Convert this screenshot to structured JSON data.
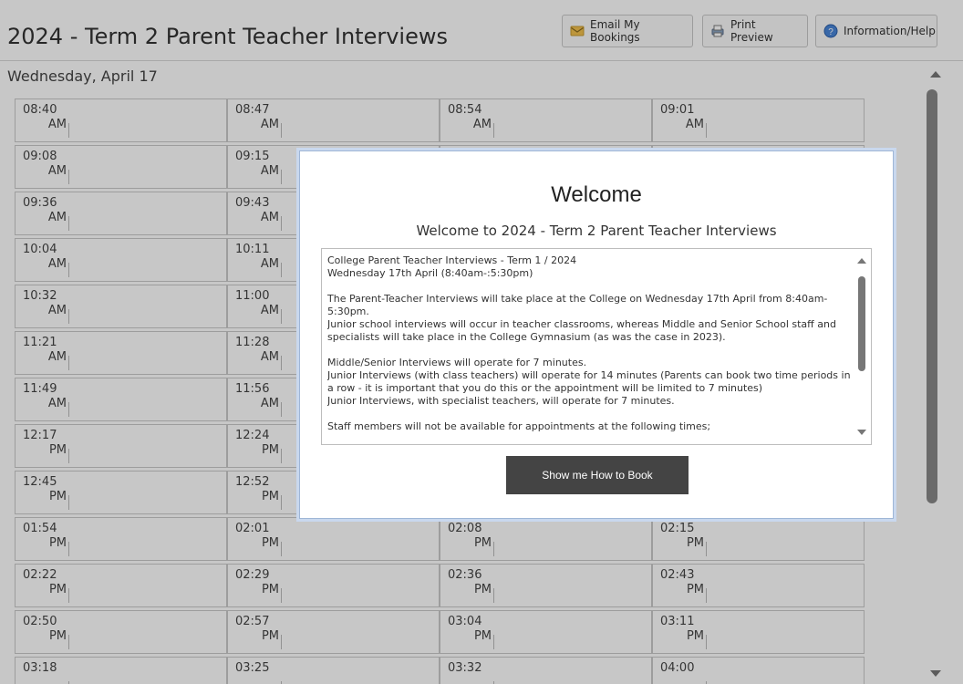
{
  "header": {
    "title": "2024 - Term 2 Parent Teacher Interviews",
    "buttons": [
      {
        "label": "Email My Bookings",
        "icon": "email-icon"
      },
      {
        "label": "Print Preview",
        "icon": "print-icon"
      },
      {
        "label": "Information/Help",
        "icon": "help-icon"
      }
    ]
  },
  "day_label": "Wednesday, April 17",
  "slots": [
    [
      {
        "time": "08:40",
        "ampm": "AM"
      },
      {
        "time": "08:47",
        "ampm": "AM"
      },
      {
        "time": "08:54",
        "ampm": "AM"
      },
      {
        "time": "09:01",
        "ampm": "AM"
      }
    ],
    [
      {
        "time": "09:08",
        "ampm": "AM"
      },
      {
        "time": "09:15",
        "ampm": "AM"
      },
      {
        "time": "",
        "ampm": ""
      },
      {
        "time": "",
        "ampm": ""
      }
    ],
    [
      {
        "time": "09:36",
        "ampm": "AM"
      },
      {
        "time": "09:43",
        "ampm": "AM"
      },
      {
        "time": "",
        "ampm": ""
      },
      {
        "time": "",
        "ampm": ""
      }
    ],
    [
      {
        "time": "10:04",
        "ampm": "AM"
      },
      {
        "time": "10:11",
        "ampm": "AM"
      },
      {
        "time": "",
        "ampm": ""
      },
      {
        "time": "",
        "ampm": ""
      }
    ],
    [
      {
        "time": "10:32",
        "ampm": "AM"
      },
      {
        "time": "11:00",
        "ampm": "AM"
      },
      {
        "time": "",
        "ampm": ""
      },
      {
        "time": "",
        "ampm": ""
      }
    ],
    [
      {
        "time": "11:21",
        "ampm": "AM"
      },
      {
        "time": "11:28",
        "ampm": "AM"
      },
      {
        "time": "",
        "ampm": ""
      },
      {
        "time": "",
        "ampm": ""
      }
    ],
    [
      {
        "time": "11:49",
        "ampm": "AM"
      },
      {
        "time": "11:56",
        "ampm": "AM"
      },
      {
        "time": "",
        "ampm": ""
      },
      {
        "time": "",
        "ampm": ""
      }
    ],
    [
      {
        "time": "12:17",
        "ampm": "PM"
      },
      {
        "time": "12:24",
        "ampm": "PM"
      },
      {
        "time": "",
        "ampm": ""
      },
      {
        "time": "",
        "ampm": ""
      }
    ],
    [
      {
        "time": "12:45",
        "ampm": "PM"
      },
      {
        "time": "12:52",
        "ampm": "PM"
      },
      {
        "time": "",
        "ampm": ""
      },
      {
        "time": "",
        "ampm": ""
      }
    ],
    [
      {
        "time": "01:54",
        "ampm": "PM"
      },
      {
        "time": "02:01",
        "ampm": "PM"
      },
      {
        "time": "02:08",
        "ampm": "PM"
      },
      {
        "time": "02:15",
        "ampm": "PM"
      }
    ],
    [
      {
        "time": "02:22",
        "ampm": "PM"
      },
      {
        "time": "02:29",
        "ampm": "PM"
      },
      {
        "time": "02:36",
        "ampm": "PM"
      },
      {
        "time": "02:43",
        "ampm": "PM"
      }
    ],
    [
      {
        "time": "02:50",
        "ampm": "PM"
      },
      {
        "time": "02:57",
        "ampm": "PM"
      },
      {
        "time": "03:04",
        "ampm": "PM"
      },
      {
        "time": "03:11",
        "ampm": "PM"
      }
    ],
    [
      {
        "time": "03:18",
        "ampm": ""
      },
      {
        "time": "03:25",
        "ampm": ""
      },
      {
        "time": "03:32",
        "ampm": ""
      },
      {
        "time": "04:00",
        "ampm": ""
      }
    ]
  ],
  "modal": {
    "heading": "Welcome",
    "subheading": "Welcome to 2024 - Term 2 Parent Teacher Interviews",
    "paragraphs": [
      "College Parent Teacher Interviews - Term 1 / 2024\nWednesday 17th April (8:40am-:5:30pm)",
      "The Parent-Teacher Interviews will take place at the College on Wednesday 17th April from 8:40am-5:30pm.\nJunior school interviews will occur in teacher classrooms, whereas Middle and Senior School staff and specialists will take place in the College Gymnasium (as was the case in 2023).",
      "Middle/Senior Interviews will operate for 7 minutes.\nJunior Interviews (with class teachers) will operate for 14 minutes (Parents can book two time periods in a row - it is important that you do this or the appointment will be limited to 7 minutes)\nJunior Interviews, with specialist teachers, will operate for 7 minutes.",
      "Staff members will not be available for appointments at the following times;"
    ],
    "button_label": "Show me How to Book"
  }
}
